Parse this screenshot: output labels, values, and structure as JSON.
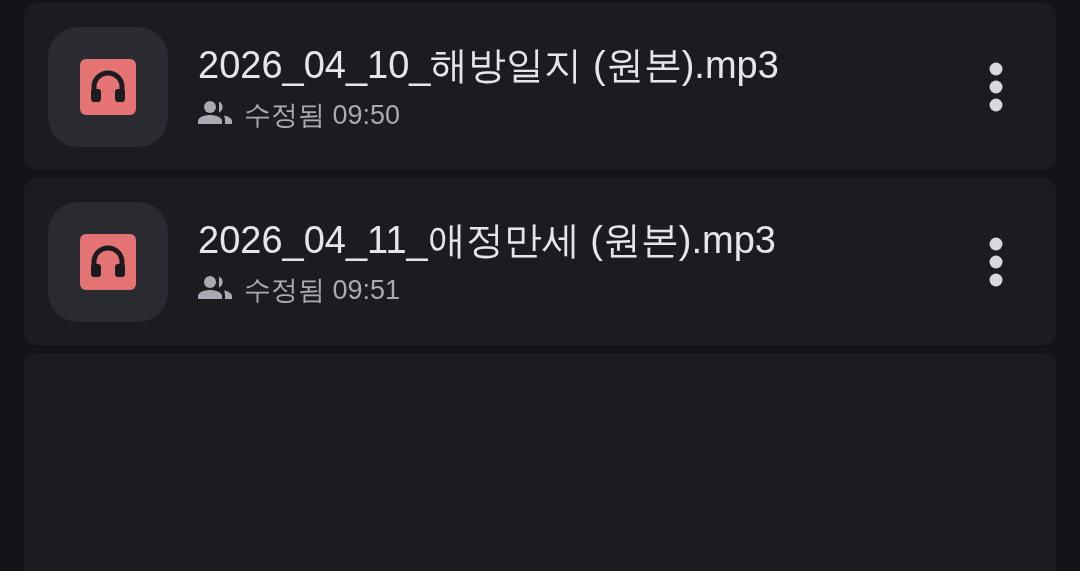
{
  "files": [
    {
      "name": "2026_04_10_해방일지 (원본).mp3",
      "shared": true,
      "modified": "수정됨 09:50"
    },
    {
      "name": "2026_04_11_애정만세 (원본).mp3",
      "shared": true,
      "modified": "수정됨 09:51"
    }
  ]
}
